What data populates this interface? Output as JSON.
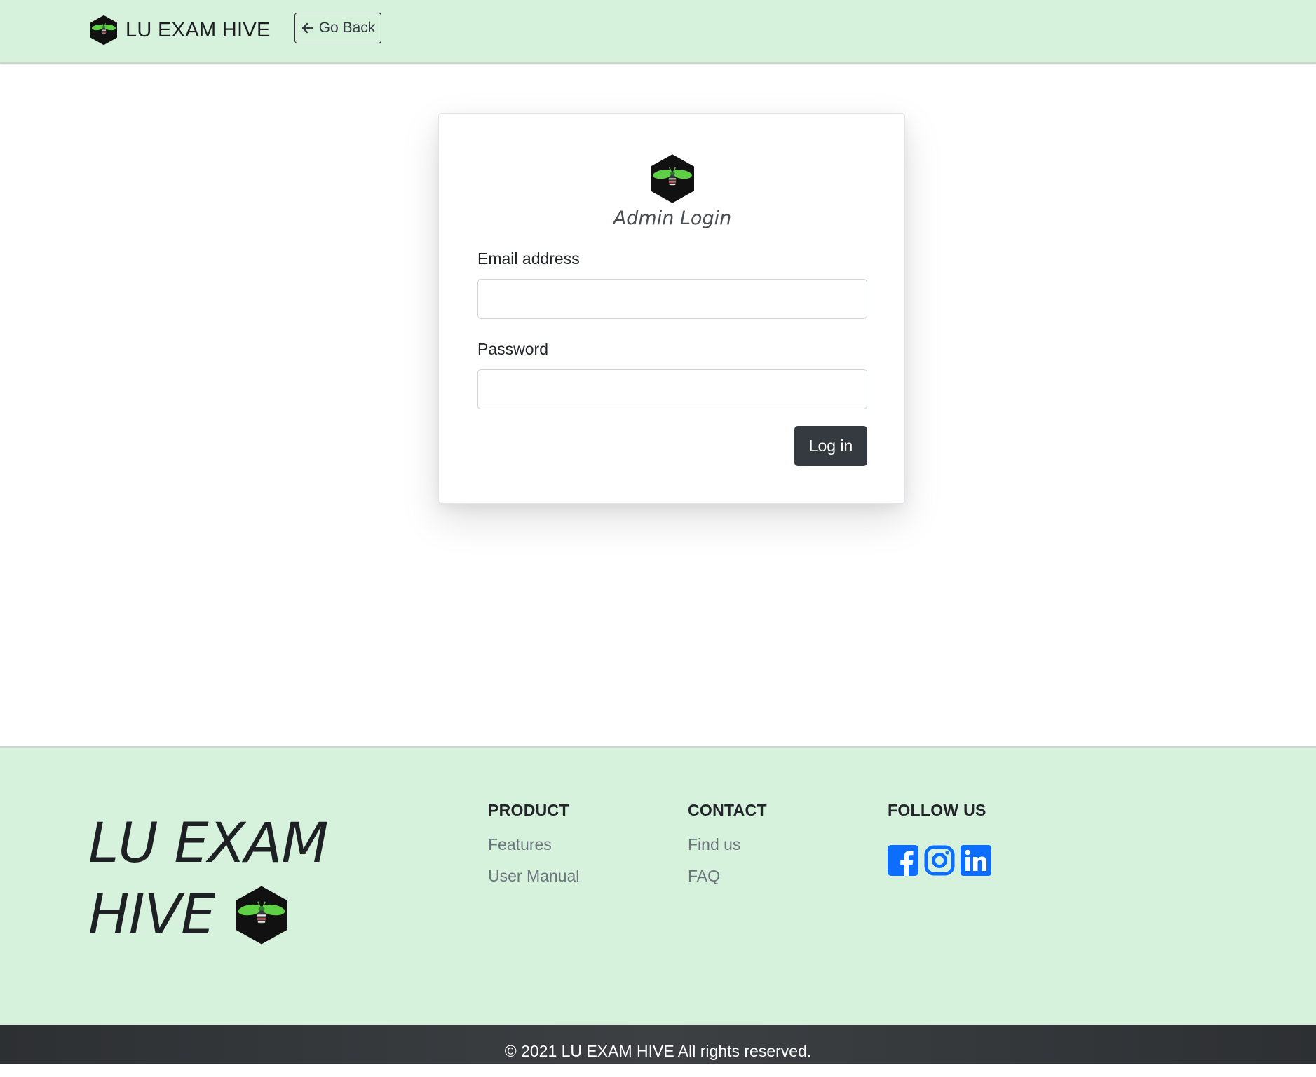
{
  "navbar": {
    "brand_text": "LU EXAM HIVE",
    "go_back_label": "Go Back"
  },
  "login": {
    "title": "Admin Login",
    "email_label": "Email address",
    "email_value": "",
    "password_label": "Password",
    "password_value": "",
    "submit_label": "Log in"
  },
  "footer": {
    "brand_line1": "LU EXAM",
    "brand_line2": "HIVE",
    "columns": [
      {
        "heading": "PRODUCT",
        "links": [
          "Features",
          "User Manual"
        ]
      },
      {
        "heading": "CONTACT",
        "links": [
          "Find us",
          "FAQ"
        ]
      },
      {
        "heading": "FOLLOW US",
        "icons": [
          "facebook-icon",
          "instagram-icon",
          "linkedin-icon"
        ]
      }
    ],
    "copyright": "© 2021 LU EXAM HIVE All rights reserved."
  },
  "colors": {
    "header_footer_bg": "#d7f2dc",
    "button_dark": "#343a40",
    "social_blue": "#0d6efd",
    "bee_green": "#5fcf45"
  }
}
